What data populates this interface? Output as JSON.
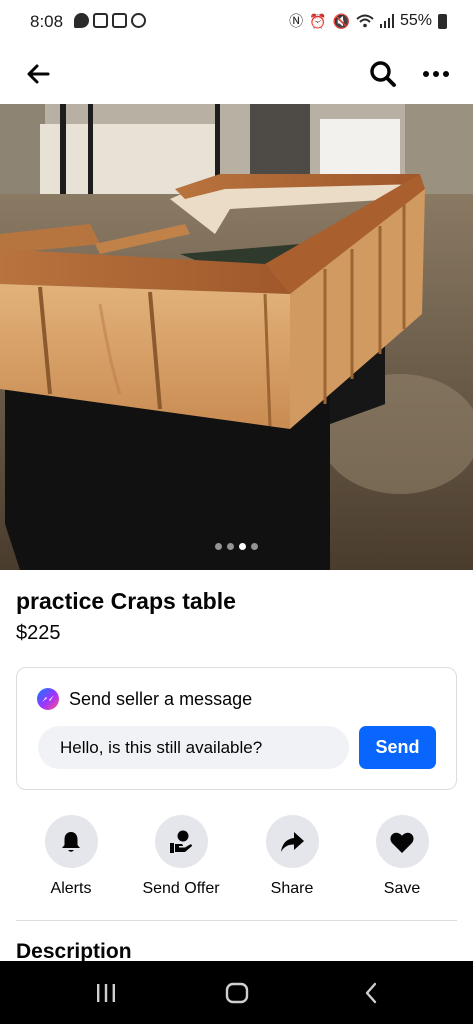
{
  "status_bar": {
    "time": "8:08",
    "battery": "55%"
  },
  "header": {
    "back_icon": "arrow-left-icon",
    "search_icon": "search-icon",
    "more_icon": "more-horizontal-icon"
  },
  "photo": {
    "dots_total": 4,
    "active_dot": 2
  },
  "listing": {
    "title": "practice Craps table",
    "price": "$225"
  },
  "message_card": {
    "title": "Send seller a message",
    "input_value": "Hello, is this still available?",
    "send_label": "Send"
  },
  "actions": [
    {
      "label": "Alerts",
      "icon": "bell-icon"
    },
    {
      "label": "Send Offer",
      "icon": "hand-offer-icon"
    },
    {
      "label": "Share",
      "icon": "share-arrow-icon"
    },
    {
      "label": "Save",
      "icon": "heart-icon"
    }
  ],
  "description": {
    "heading": "Description"
  },
  "colors": {
    "accent": "#0866ff",
    "circle_bg": "#e4e6eb",
    "input_bg": "#f0f2f5"
  }
}
